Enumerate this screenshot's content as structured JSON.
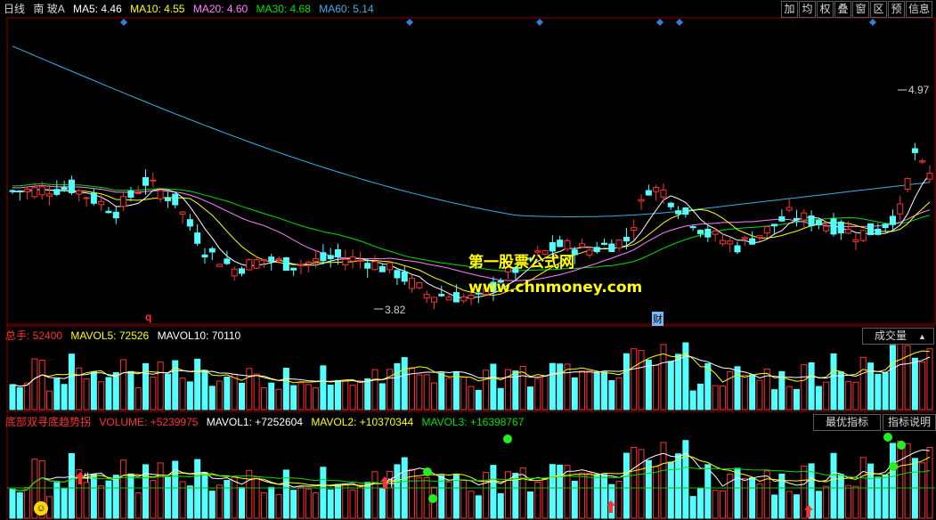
{
  "colors": {
    "up": "#ff3232",
    "down": "#54ffff",
    "ma5": "#ffffff",
    "ma10": "#ffff00",
    "ma20": "#ff80ff",
    "ma30": "#00e000",
    "ma60": "#3ab0e0",
    "diamond": "#2f7fd8",
    "watermark": "#ffff00"
  },
  "main_header": {
    "period": "日线",
    "stock_name": "南 玻A",
    "ma5": "MA5: 4.46",
    "ma10": "MA10: 4.55",
    "ma20": "MA20: 4.60",
    "ma30": "MA30: 4.68",
    "ma60": "MA60: 5.14"
  },
  "toolbar": {
    "buttons": [
      "加",
      "均",
      "权",
      "叠",
      "窗",
      "区",
      "预",
      "信息"
    ],
    "arrow_up": "▲"
  },
  "main_chart": {
    "high_label": "4.97",
    "low_label": "3.82",
    "marker_q": "q",
    "marker_cai": "财"
  },
  "watermark": {
    "line1": "第一股票公式网",
    "line2": "www.chnmoney.com"
  },
  "volume_header": {
    "total": "总手: 52400",
    "mavol5": "MAVOL5: 72526",
    "mavol10": "MAVOL10: 70110",
    "dropdown": "成交量"
  },
  "indicator_header": {
    "name": "底部双寻底趋势拐",
    "volume": "VOLUME: +5239975",
    "mavol1": "MAVOL1: +7252604",
    "mavol2": "MAVOL2: +10370344",
    "mavol3": "MAVOL3: +16398767",
    "best_button": "最优指标",
    "help_button": "指标说明"
  },
  "indicator_marks": {
    "niu": "牛"
  },
  "chart_data": {
    "type": "candlestick",
    "candles_approx": 125,
    "price_high": 4.97,
    "price_low": 3.82,
    "last_ma": {
      "MA5": 4.46,
      "MA10": 4.55,
      "MA20": 4.6,
      "MA30": 4.68,
      "MA60": 5.14
    },
    "last_volume": 52400,
    "last_mavol5": 72526,
    "last_mavol10": 70110
  }
}
